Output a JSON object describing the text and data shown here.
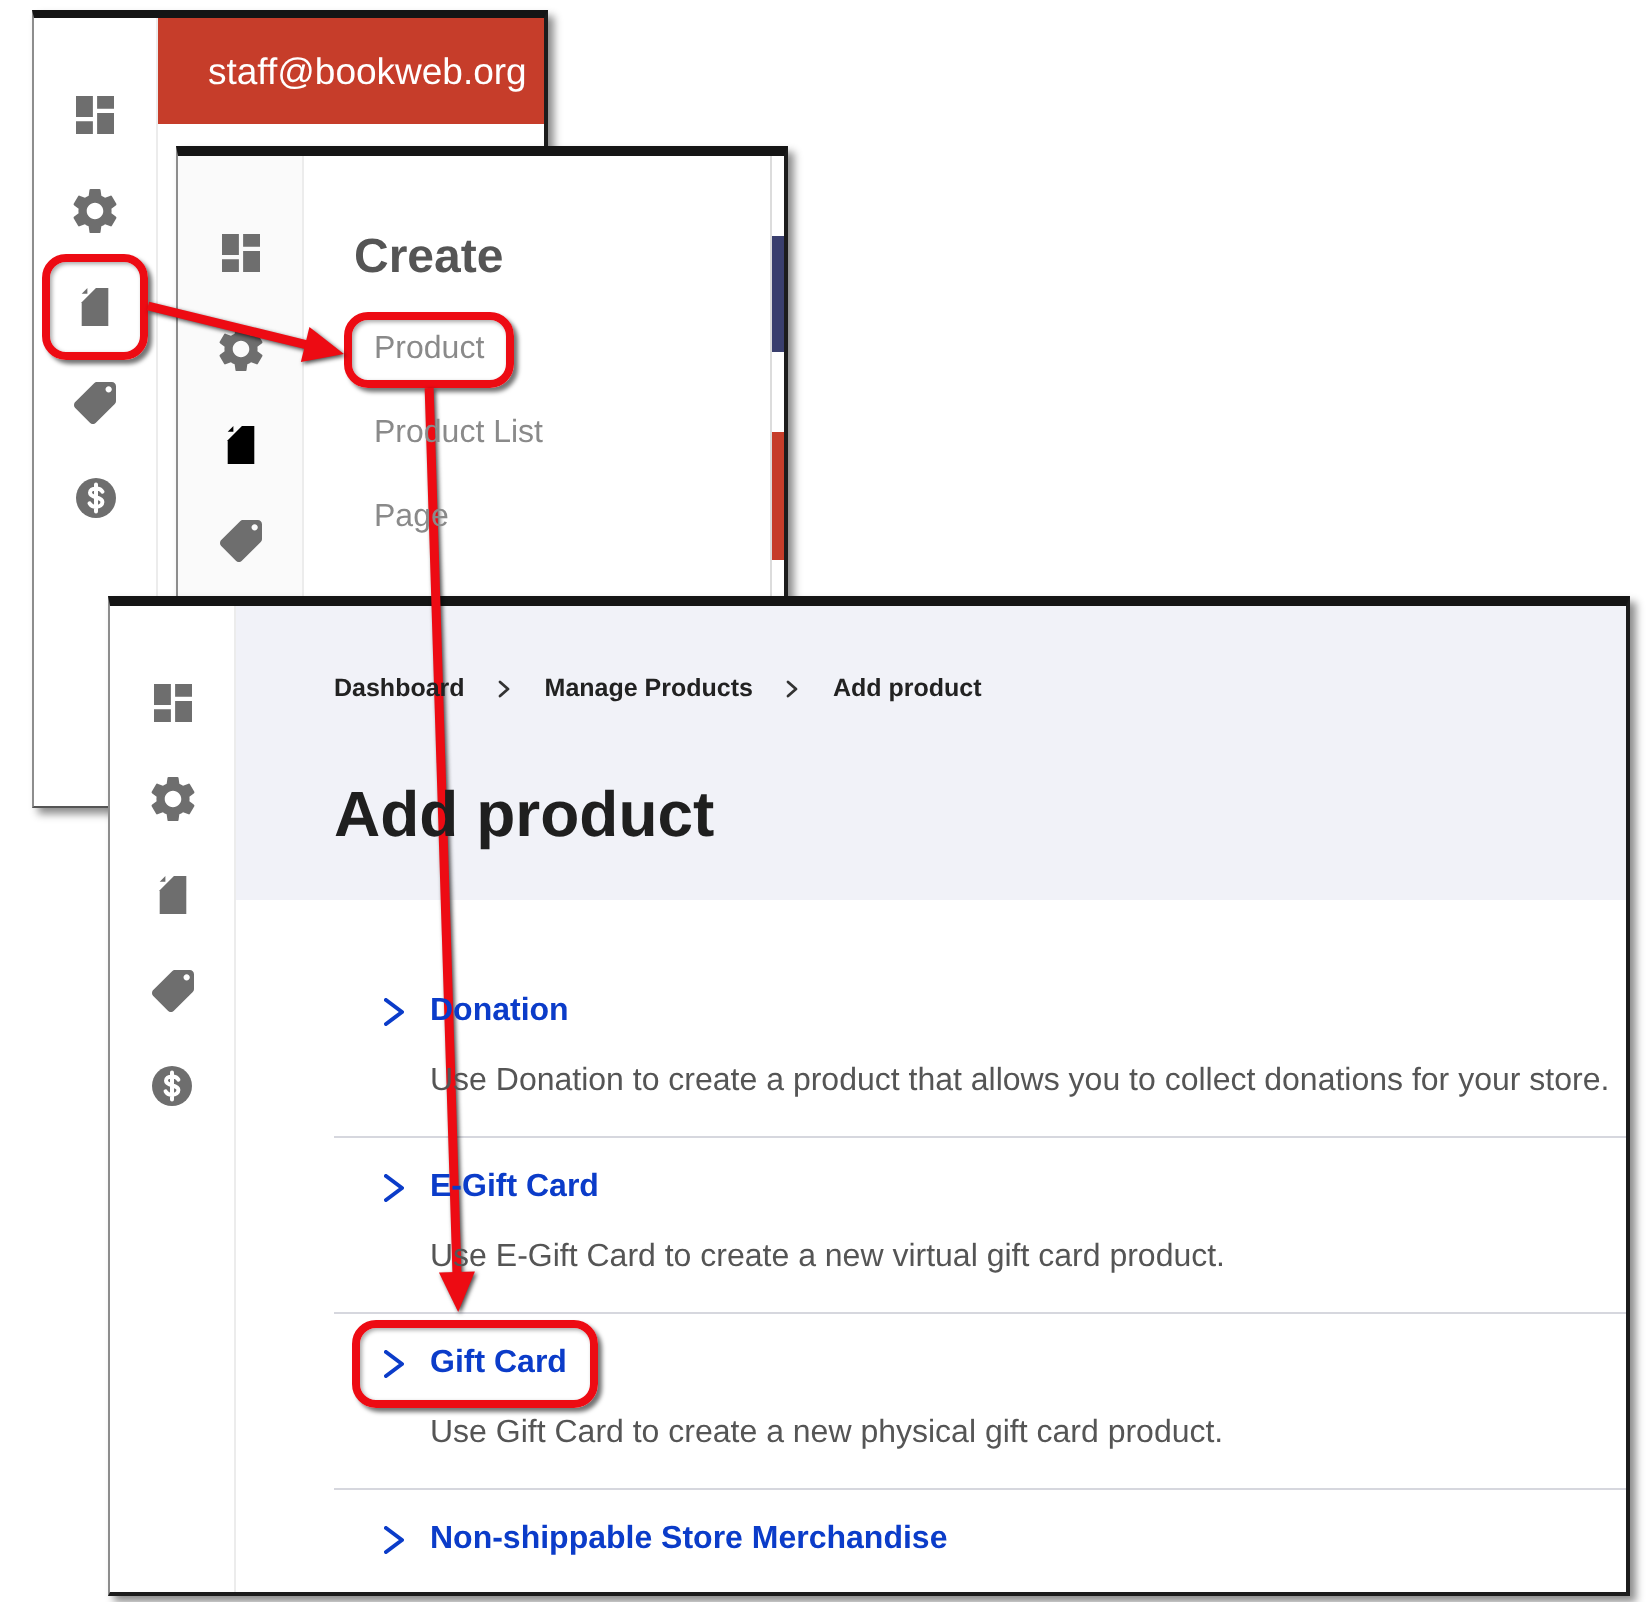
{
  "windows": [
    {
      "kind": "account",
      "sidebar": [
        {
          "kind": "dashboard",
          "selected": false,
          "highlighted": false
        },
        {
          "kind": "settings",
          "selected": false,
          "highlighted": false
        },
        {
          "kind": "page",
          "selected": false,
          "highlighted": true
        },
        {
          "kind": "tag",
          "selected": false,
          "highlighted": false
        },
        {
          "kind": "dollar",
          "selected": false,
          "highlighted": false
        }
      ],
      "header": {
        "email": "staff@bookweb.org"
      }
    },
    {
      "kind": "menu",
      "sidebar": [
        {
          "kind": "dashboard",
          "selected": false
        },
        {
          "kind": "settings",
          "selected": false
        },
        {
          "kind": "page",
          "selected": true
        },
        {
          "kind": "tag",
          "selected": false
        }
      ],
      "menu": {
        "title": "Create",
        "items": [
          {
            "label": "Product",
            "highlighted": true
          },
          {
            "label": "Product List",
            "highlighted": false
          },
          {
            "label": "Page",
            "highlighted": false
          }
        ]
      }
    },
    {
      "kind": "page",
      "sidebar": [
        {
          "kind": "dashboard",
          "selected": false
        },
        {
          "kind": "settings",
          "selected": false
        },
        {
          "kind": "page",
          "selected": false
        },
        {
          "kind": "tag",
          "selected": false
        },
        {
          "kind": "dollar",
          "selected": false
        }
      ],
      "breadcrumb": [
        "Dashboard",
        "Manage Products",
        "Add product"
      ],
      "title": "Add product",
      "product_types": [
        {
          "name": "Donation",
          "description": "Use Donation to create a product that allows you to collect donations for your store.",
          "highlighted": false
        },
        {
          "name": "E-Gift Card",
          "description": "Use E-Gift Card to create a new virtual gift card product.",
          "highlighted": false
        },
        {
          "name": "Gift Card",
          "description": "Use Gift Card to create a new physical gift card product.",
          "highlighted": true
        },
        {
          "name": "Non-shippable Store Merchandise",
          "highlighted": false
        }
      ]
    }
  ]
}
